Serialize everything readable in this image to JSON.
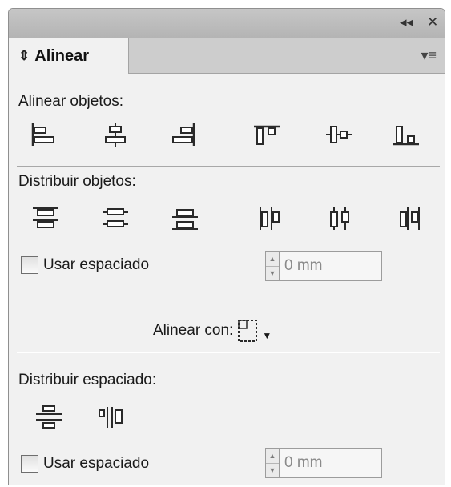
{
  "titlebar": {
    "collapse_icon": "double-chevron-left-icon",
    "close_icon": "close-icon",
    "collapse_glyph": "◂◂",
    "close_glyph": "✕"
  },
  "tab": {
    "arrows": "⇕",
    "label": "Alinear",
    "menu_glyph": "▾≡"
  },
  "align_objects": {
    "label": "Alinear objetos:",
    "buttons": [
      "align-left-edges-icon",
      "align-horizontal-centers-icon",
      "align-right-edges-icon",
      "align-top-edges-icon",
      "align-vertical-centers-icon",
      "align-bottom-edges-icon"
    ]
  },
  "distribute_objects": {
    "label": "Distribuir objetos:",
    "buttons": [
      "distribute-top-edges-icon",
      "distribute-vertical-centers-icon",
      "distribute-bottom-edges-icon",
      "distribute-left-edges-icon",
      "distribute-horizontal-centers-icon",
      "distribute-right-edges-icon"
    ],
    "use_spacing_label": "Usar espaciado",
    "use_spacing_checked": false,
    "spacing_value": "0 mm"
  },
  "align_to": {
    "label": "Alinear con:",
    "icon": "align-to-selection-icon"
  },
  "distribute_spacing": {
    "label": "Distribuir espaciado:",
    "buttons": [
      "vertical-distribute-space-icon",
      "horizontal-distribute-space-icon"
    ],
    "use_spacing_label": "Usar espaciado",
    "use_spacing_checked": false,
    "spacing_value": "0 mm"
  },
  "colors": {
    "panel_bg": "#f1f1f1",
    "titlebar_bg": "#bebebe",
    "icon_stroke": "#2a2a2a"
  }
}
